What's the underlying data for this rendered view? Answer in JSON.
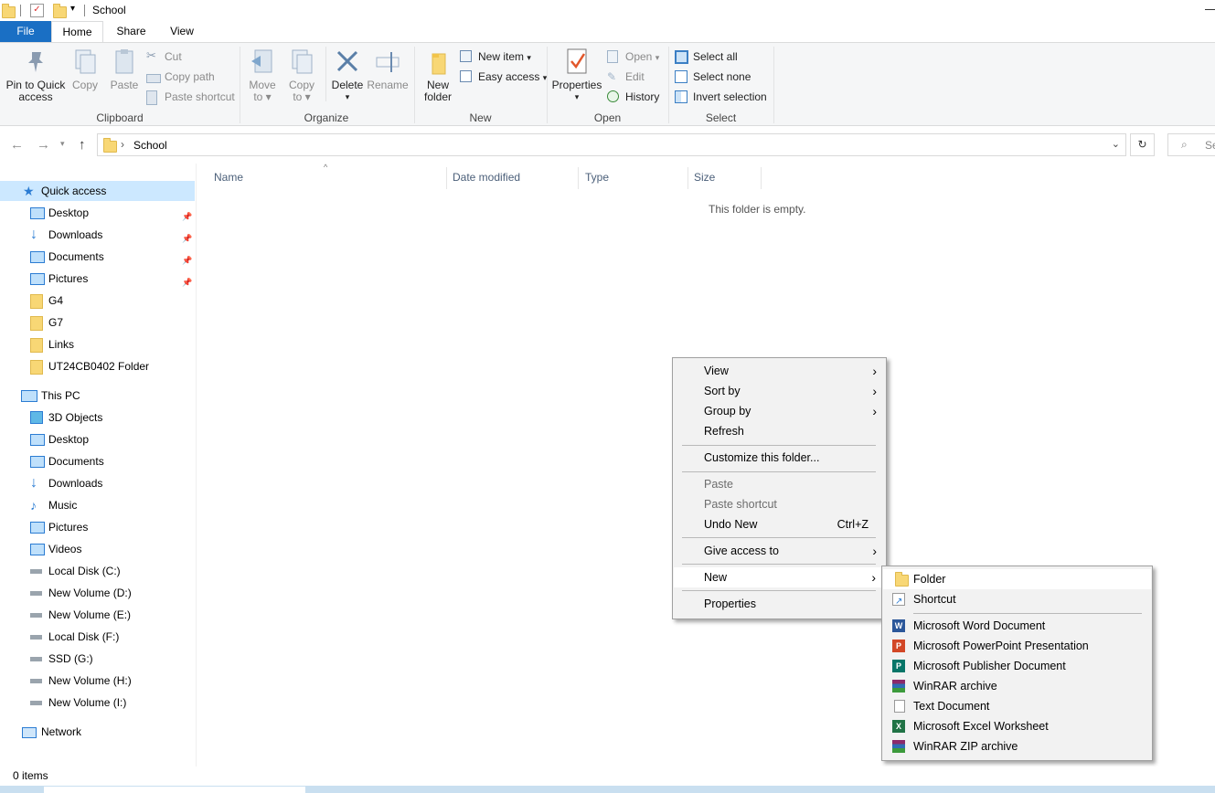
{
  "window": {
    "title": "School"
  },
  "tabs": {
    "file": "File",
    "home": "Home",
    "share": "Share",
    "view": "View"
  },
  "ribbon": {
    "clipboard": {
      "label": "Clipboard",
      "pin_line1": "Pin to Quick",
      "pin_line2": "access",
      "copy": "Copy",
      "paste": "Paste",
      "cut": "Cut",
      "copy_path": "Copy path",
      "paste_shortcut": "Paste shortcut"
    },
    "organize": {
      "label": "Organize",
      "move_line1": "Move",
      "move_line2": "to",
      "copy_line1": "Copy",
      "copy_line2": "to",
      "delete": "Delete",
      "rename": "Rename"
    },
    "new": {
      "label": "New",
      "new_folder_line1": "New",
      "new_folder_line2": "folder",
      "new_item": "New item",
      "easy_access": "Easy access"
    },
    "open": {
      "label": "Open",
      "properties": "Properties",
      "open": "Open",
      "edit": "Edit",
      "history": "History"
    },
    "select": {
      "label": "Select",
      "select_all": "Select all",
      "select_none": "Select none",
      "invert_selection": "Invert selection"
    }
  },
  "address": {
    "path": "School",
    "search_placeholder": "Se"
  },
  "nav": {
    "quick_access": "Quick access",
    "quick_items": [
      "Desktop",
      "Downloads",
      "Documents",
      "Pictures",
      "G4",
      "G7",
      "Links",
      "UT24CB0402 Folder"
    ],
    "this_pc": "This PC",
    "pc_items": [
      "3D Objects",
      "Desktop",
      "Documents",
      "Downloads",
      "Music",
      "Pictures",
      "Videos",
      "Local Disk (C:)",
      "New Volume (D:)",
      "New Volume (E:)",
      "Local Disk (F:)",
      "SSD (G:)",
      "New Volume (H:)",
      "New Volume (I:)"
    ],
    "network": "Network"
  },
  "columns": {
    "name": "Name",
    "date_modified": "Date modified",
    "type": "Type",
    "size": "Size"
  },
  "content": {
    "empty_message": "This folder is empty."
  },
  "status": {
    "items": "0 items"
  },
  "context_menu": {
    "view": "View",
    "sort_by": "Sort by",
    "group_by": "Group by",
    "refresh": "Refresh",
    "customize": "Customize this folder...",
    "paste": "Paste",
    "paste_shortcut": "Paste shortcut",
    "undo_new": "Undo New",
    "undo_shortcut": "Ctrl+Z",
    "give_access": "Give access to",
    "new": "New",
    "properties": "Properties"
  },
  "new_submenu": {
    "folder": "Folder",
    "shortcut": "Shortcut",
    "word": "Microsoft Word Document",
    "powerpoint": "Microsoft PowerPoint Presentation",
    "publisher": "Microsoft Publisher Document",
    "winrar": "WinRAR archive",
    "text": "Text Document",
    "excel": "Microsoft Excel Worksheet",
    "winrar_zip": "WinRAR ZIP archive"
  },
  "colors": {
    "accent": "#1a6fc4",
    "selection": "#cce8ff",
    "folder": "#f8d775"
  }
}
